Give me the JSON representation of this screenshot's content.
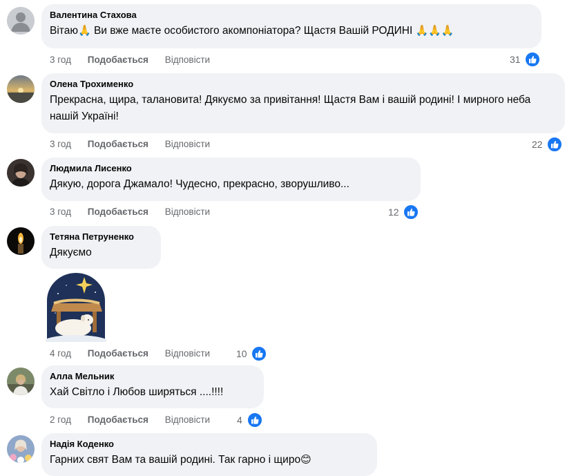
{
  "comments": [
    {
      "author": "Валентина Стахова",
      "text_a": "Вітаю",
      "text_b": " Ви вже маєте особистого акомпоніатора? Щастя Вашій РОДИНІ ",
      "emoji_pray": "🙏",
      "emoji_pray3": "🙏🙏🙏",
      "time": "3 год",
      "reactions": "31"
    },
    {
      "author": "Олена Трохименко",
      "text": "Прекрасна, щира, талановита! Дякуємо за привітання! Щастя Вам і вашій родині! І мирного неба нашій Україні!",
      "time": "3 год",
      "reactions": "22"
    },
    {
      "author": "Людмила Лисенко",
      "text": "Дякую, дорога Джамало! Чудесно, прекрасно, зворушливо...",
      "time": "3 год",
      "reactions": "12"
    },
    {
      "author": "Тетяна Петруненко",
      "text": "Дякуємо",
      "time": "4 год",
      "reactions": "10"
    },
    {
      "author": "Алла Мельник",
      "text": "Хай Світло і Любов ширяться ....!!!!",
      "time": "2 год",
      "reactions": "4"
    },
    {
      "author": "Надія Коденко",
      "text": "Гарних свят Вам та вашій родині. Так гарно і щиро",
      "emoji": "😊"
    }
  ],
  "labels": {
    "like": "Подобається",
    "reply": "Відповісти"
  },
  "colors": {
    "bubble": "#f0f2f5",
    "like_blue": "#1877f2",
    "meta_gray": "#65676b"
  }
}
